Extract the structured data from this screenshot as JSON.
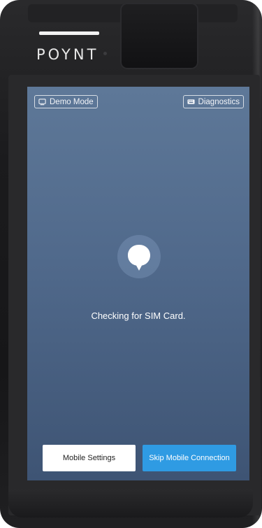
{
  "device": {
    "brand": "POYNT"
  },
  "screen": {
    "demo_mode_label": "Demo Mode",
    "diagnostics_label": "Diagnostics",
    "status_text": "Checking for SIM Card.",
    "mobile_settings_label": "Mobile Settings",
    "skip_mobile_label": "Skip Mobile Connection"
  },
  "icons": {
    "demo_mode": "monitor-icon",
    "diagnostics": "keyboard-icon",
    "status": "chat-bubble-icon"
  },
  "colors": {
    "screen_top": "#5e7898",
    "screen_bottom": "#3e5474",
    "primary_button": "#2f9be3",
    "secondary_button": "#ffffff"
  }
}
